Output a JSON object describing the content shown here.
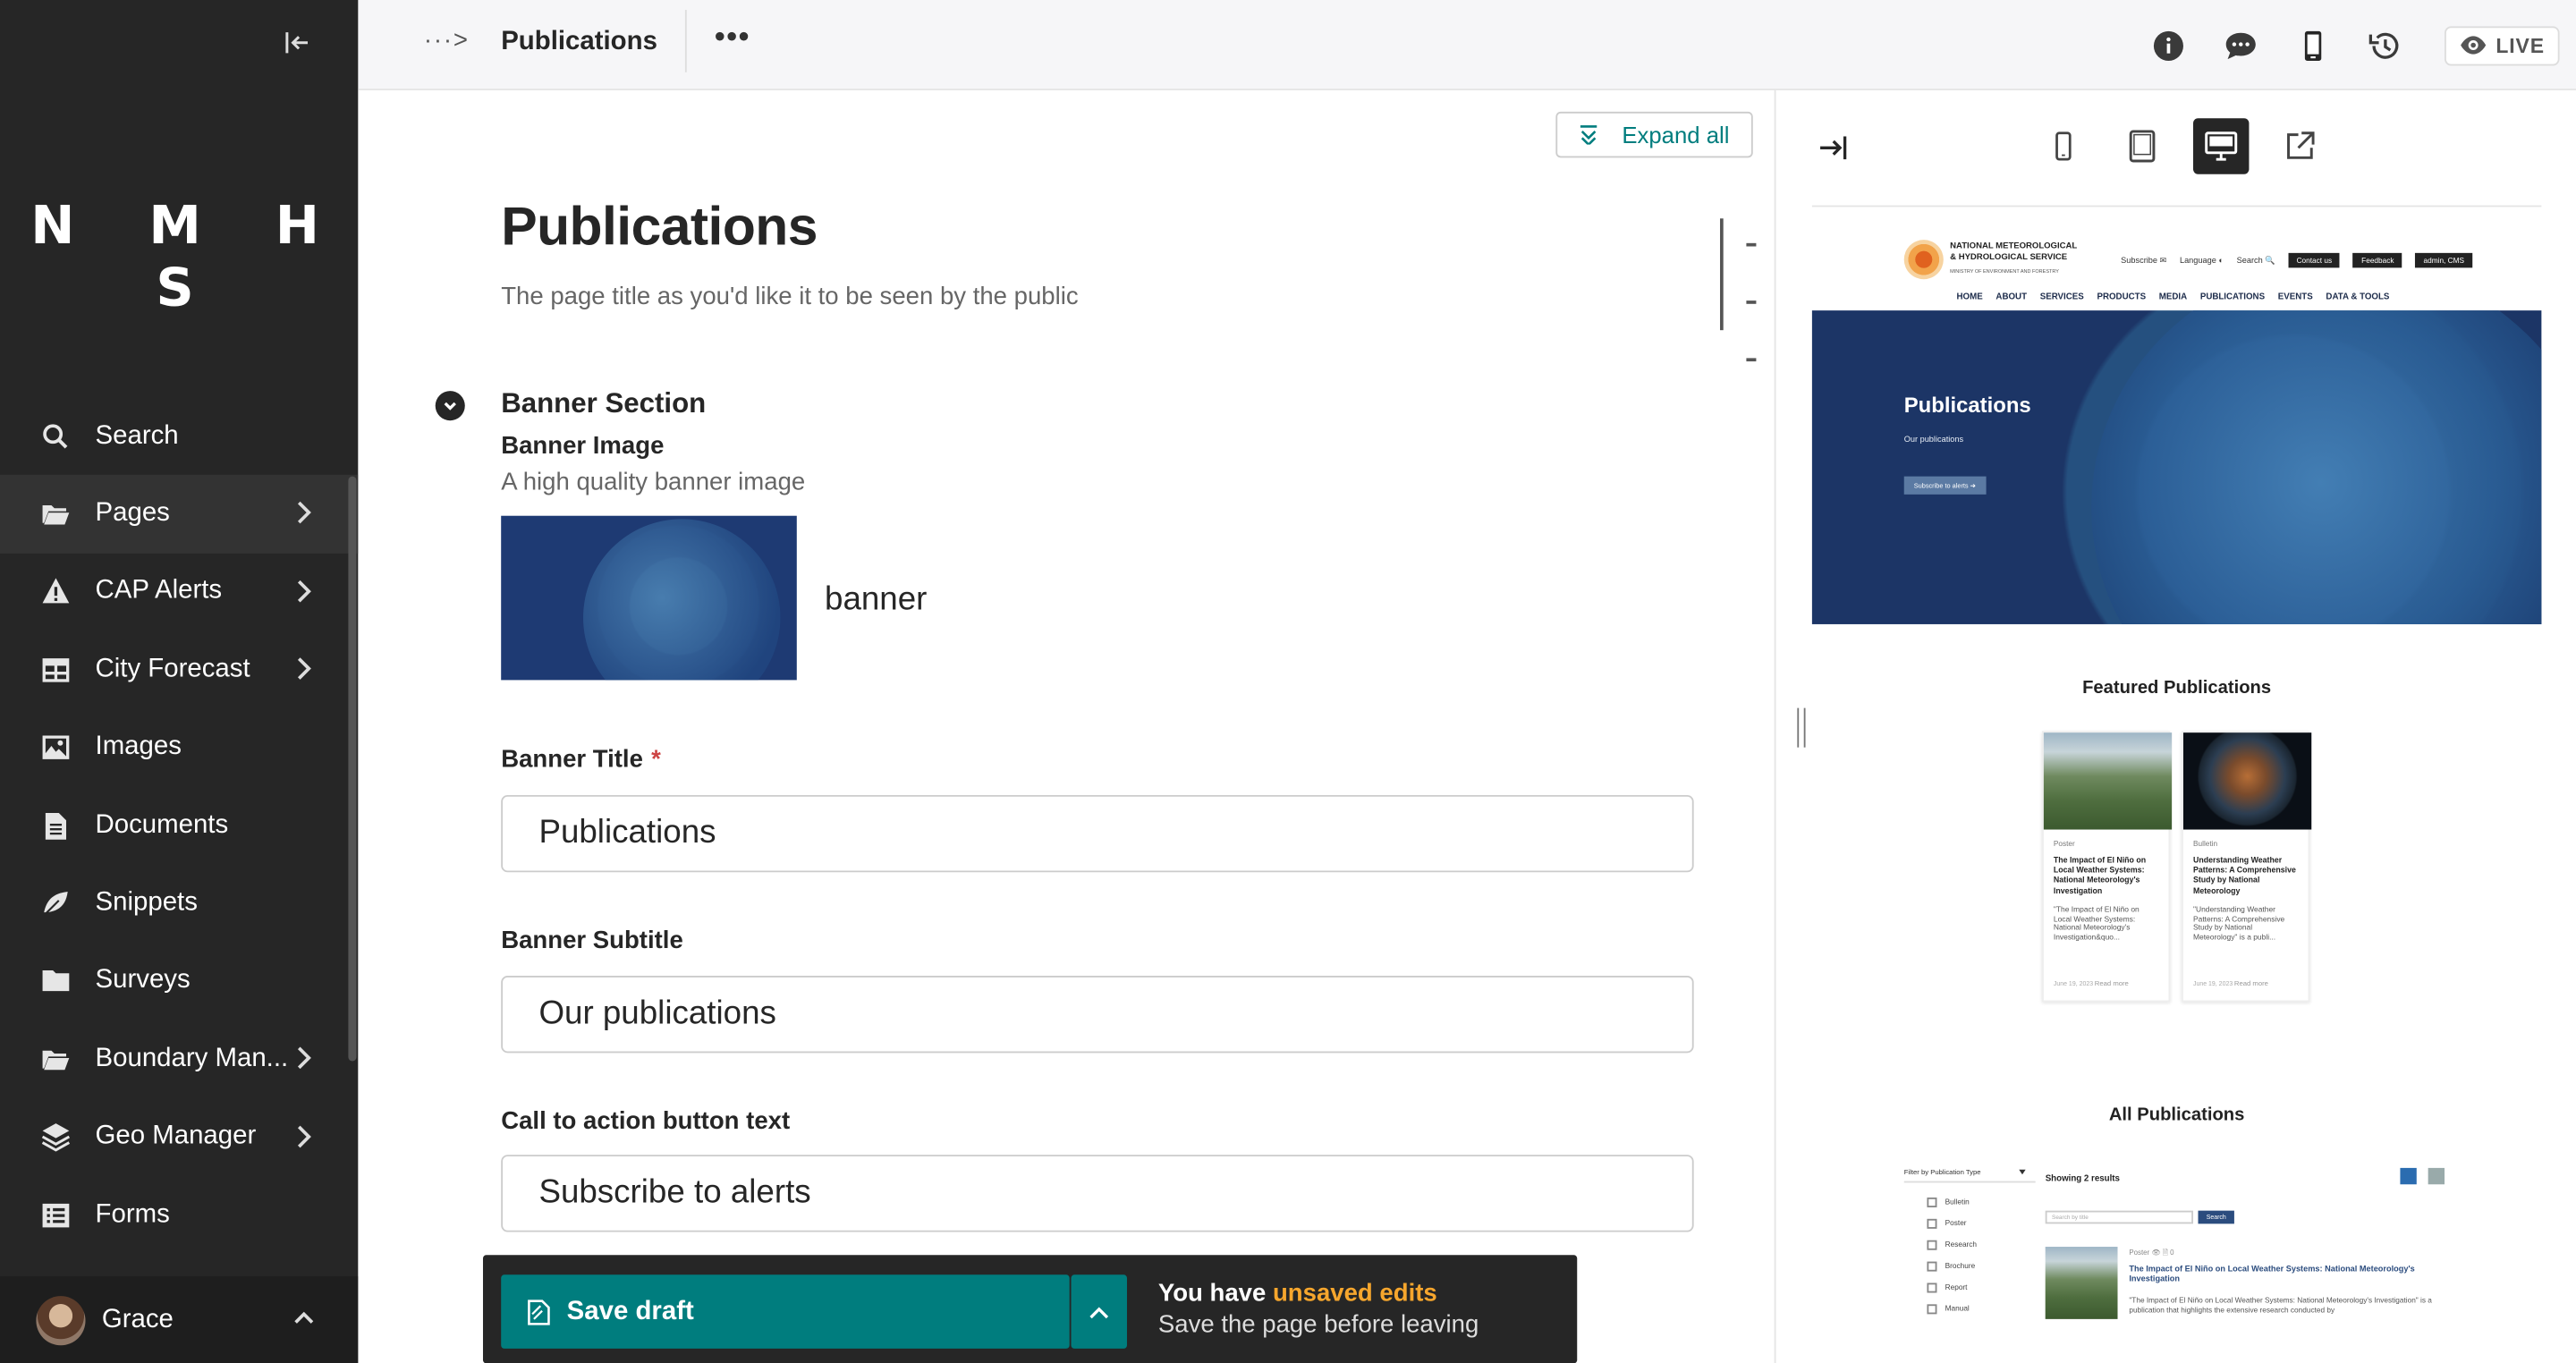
{
  "sidebar": {
    "logo": "N M H S",
    "items": [
      {
        "label": "Search",
        "icon": "search-icon",
        "has_children": false
      },
      {
        "label": "Pages",
        "icon": "folder-open-icon",
        "has_children": true
      },
      {
        "label": "CAP Alerts",
        "icon": "warning-icon",
        "has_children": true
      },
      {
        "label": "City Forecast",
        "icon": "table-icon",
        "has_children": true
      },
      {
        "label": "Images",
        "icon": "image-icon",
        "has_children": false
      },
      {
        "label": "Documents",
        "icon": "document-icon",
        "has_children": false
      },
      {
        "label": "Snippets",
        "icon": "snippet-icon",
        "has_children": false
      },
      {
        "label": "Surveys",
        "icon": "folder-icon",
        "has_children": false
      },
      {
        "label": "Boundary Man...",
        "icon": "folder-open-icon",
        "has_children": true
      },
      {
        "label": "Geo Manager",
        "icon": "layers-icon",
        "has_children": true
      },
      {
        "label": "Forms",
        "icon": "list-icon",
        "has_children": false
      }
    ],
    "user": {
      "name": "Grace"
    }
  },
  "topbar": {
    "breadcrumb": "···>",
    "title": "Publications",
    "more": "•••",
    "live_label": "LIVE"
  },
  "editor": {
    "expand_all": "Expand all",
    "page_title": "Publications",
    "page_title_help": "The page title as you'd like it to be seen by the public",
    "banner_section": "Banner Section",
    "banner_image_label": "Banner Image",
    "banner_image_help": "A high quality banner image",
    "banner_image_name": "banner",
    "banner_title_label": "Banner Title",
    "required_mark": "*",
    "banner_title_value": "Publications",
    "banner_subtitle_label": "Banner Subtitle",
    "banner_subtitle_value": "Our publications",
    "cta_label": "Call to action button text",
    "cta_value": "Subscribe to alerts"
  },
  "savebar": {
    "save_label": "Save draft",
    "msg_prefix": "You have ",
    "msg_highlight": "unsaved edits",
    "msg_sub": "Save the page before leaving"
  },
  "preview": {
    "site": {
      "org_line1": "NATIONAL METEOROLOGICAL",
      "org_line2": "& HYDROLOGICAL SERVICE",
      "ministry": "MINISTRY OF ENVIRONMENT AND FORESTRY",
      "subscribe": "Subscribe ✉",
      "language": "Language ◐",
      "search": "Search 🔍",
      "contact": "Contact us",
      "feedback": "Feedback",
      "admin": "admin, CMS",
      "menu": [
        "HOME",
        "ABOUT",
        "SERVICES",
        "PRODUCTS",
        "MEDIA",
        "PUBLICATIONS",
        "EVENTS",
        "DATA & TOOLS"
      ],
      "hero_title": "Publications",
      "hero_sub": "Our publications",
      "hero_btn": "Subscribe to alerts ➔",
      "featured_title": "Featured Publications",
      "cards": [
        {
          "type": "Poster",
          "title": "The Impact of El Niño on Local Weather Systems: National Meteorology's Investigation",
          "desc": "\"The Impact of El Niño on Local Weather Systems: National Meteorology's Investigation&quo...",
          "date": "June 19, 2023",
          "more": "Read more"
        },
        {
          "type": "Bulletin",
          "title": "Understanding Weather Patterns: A Comprehensive Study by National Meteorology",
          "desc": "\"Understanding Weather Patterns: A Comprehensive Study by National Meteorology\" is a publi...",
          "date": "June 19, 2023",
          "more": "Read more"
        }
      ],
      "all_title": "All Publications",
      "filter_head": "Filter by Publication Type",
      "filters": [
        "Bulletin",
        "Poster",
        "Research",
        "Brochure",
        "Report",
        "Manual"
      ],
      "results_count": "Showing 2 results",
      "search_placeholder": "Search by title",
      "search_btn": "Search",
      "result": {
        "type": "Poster   👁   🗎 0",
        "title": "The Impact of El Niño on Local Weather Systems: National Meteorology's Investigation",
        "desc": "\"The Impact of El Niño on Local Weather Systems: National Meteorology's Investigation\" is a publication that highlights the extensive research conducted by"
      }
    }
  },
  "colors": {
    "accent": "#007d7e",
    "sidebar": "#262626",
    "warning": "#f6a62d",
    "required": "#cd4444"
  }
}
